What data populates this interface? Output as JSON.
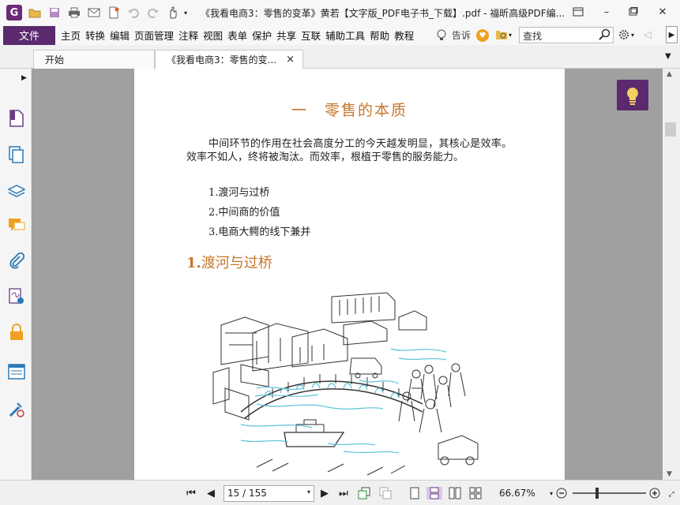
{
  "window": {
    "title": "《我看电商3：零售的变革》黄若【文字版_PDF电子书_下载】.pdf - 福昕高级PDF编...",
    "app_logo": "G"
  },
  "menu": {
    "file": "文件",
    "items": [
      "主页",
      "转换",
      "编辑",
      "页面管理",
      "注释",
      "视图",
      "表单",
      "保护",
      "共享",
      "互联",
      "辅助工具",
      "帮助",
      "教程"
    ],
    "tell": "告诉",
    "search_placeholder": "查找"
  },
  "tabs": [
    {
      "label": "开始"
    },
    {
      "label": "《我看电商3：零售的变...",
      "close": "×"
    }
  ],
  "document": {
    "chapter_title": "一　零售的本质",
    "paragraph": "中间环节的作用在社会高度分工的今天越发明显，其核心是效率。效率不如人，终将被淘汰。而效率，根植于零售的服务能力。",
    "toc": [
      "1.渡河与过桥",
      "2.中间商的价值",
      "3.电商大鳄的线下兼并"
    ],
    "section_number": "1.",
    "section_title": "渡河与过桥"
  },
  "statusbar": {
    "page_display": "15 / 155",
    "zoom": "66.67%"
  },
  "colors": {
    "brand": "#5b2a6e",
    "heading": "#c8762a",
    "doc_bg": "#a0a0a0"
  }
}
